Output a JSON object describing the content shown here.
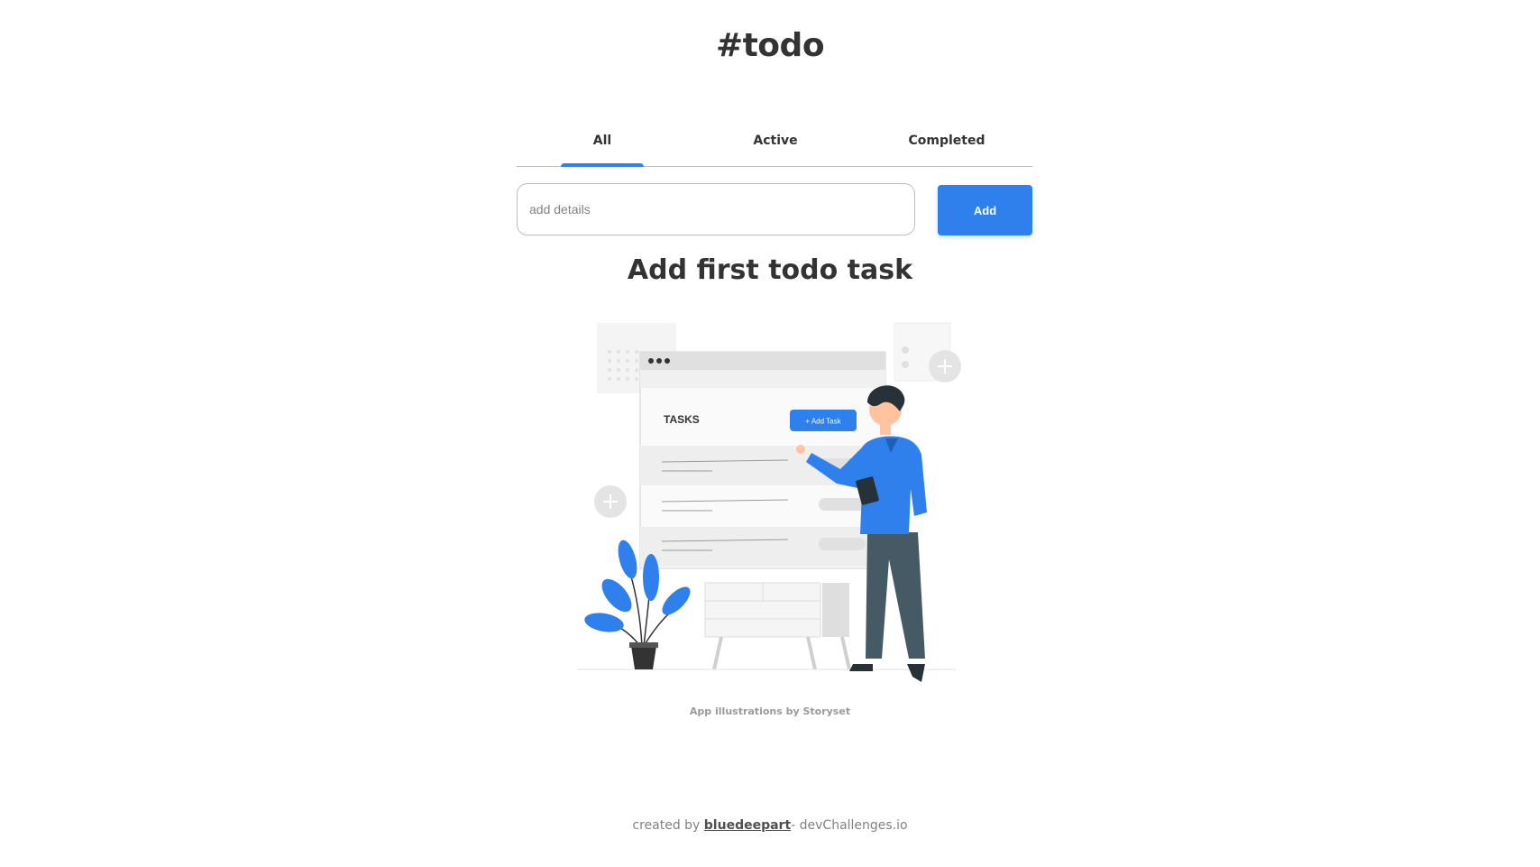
{
  "app": {
    "title": "#todo"
  },
  "tabs": [
    {
      "label": "All"
    },
    {
      "label": "Active"
    },
    {
      "label": "Completed"
    }
  ],
  "add_form": {
    "placeholder": "add details",
    "button_label": "Add"
  },
  "empty_state": {
    "heading": "Add first todo task",
    "illustration": {
      "tasks_label": "TASKS",
      "add_task_button_label": "+ Add Task"
    },
    "credit": "App illustrations by Storyset"
  },
  "footer": {
    "prefix": "created by ",
    "author": "bluedeepart",
    "suffix": "- devChallenges.io"
  },
  "colors": {
    "accent": "#2f80ed",
    "text": "#333333",
    "muted": "#828282"
  }
}
